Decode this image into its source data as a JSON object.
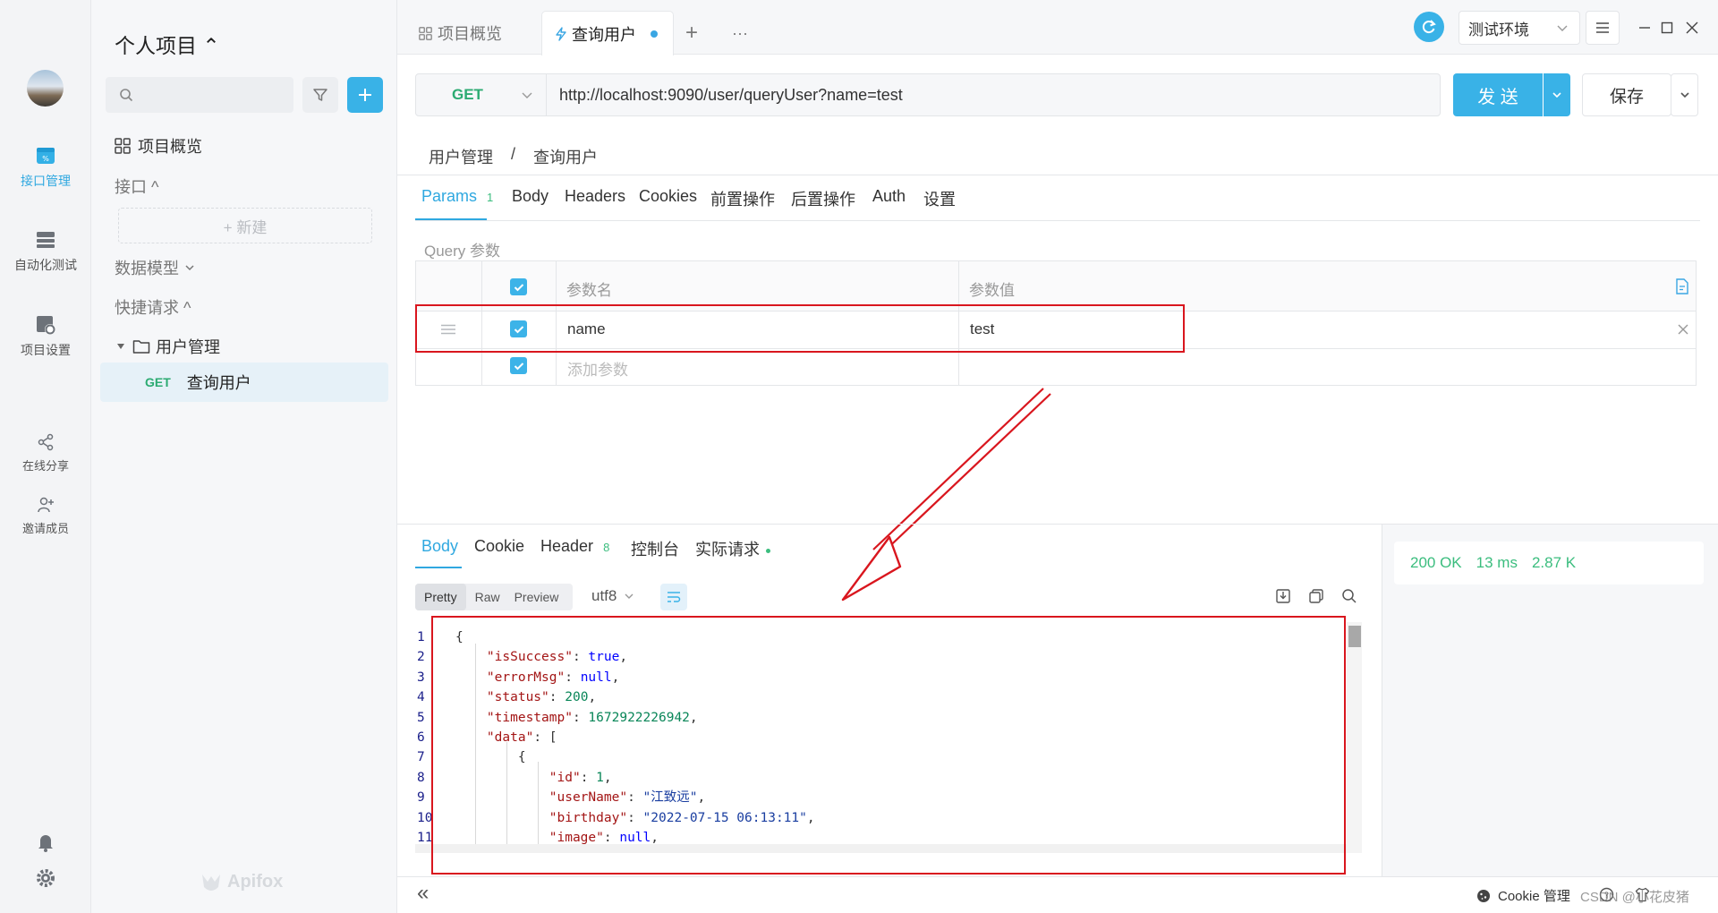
{
  "sidebar_nav": {
    "items": [
      {
        "label": "接口管理",
        "icon": "api-icon",
        "active": true
      },
      {
        "label": "自动化测试",
        "icon": "automation-icon"
      },
      {
        "label": "项目设置",
        "icon": "project-settings-icon"
      },
      {
        "label": "在线分享",
        "icon": "share-icon"
      },
      {
        "label": "邀请成员",
        "icon": "invite-member-icon"
      }
    ]
  },
  "project": {
    "title": "个人项目 ⌃",
    "search_placeholder": "",
    "overview": "项目概览",
    "api_section": "接口 ^",
    "new_label": "+ 新建",
    "data_model": "数据模型",
    "quick_request": "快捷请求 ^",
    "folder": "用户管理",
    "request_method": "GET",
    "request_name": "查询用户",
    "brand": "Apifox"
  },
  "tabs": {
    "overview": "项目概览",
    "active": "查询用户",
    "add": "+",
    "more": "···"
  },
  "env": {
    "selected": "测试环境"
  },
  "request": {
    "method": "GET",
    "url": "http://localhost:9090/user/queryUser?name=test",
    "send_label": "发 送",
    "save_label": "保存",
    "breadcrumb_parent": "用户管理",
    "breadcrumb_sep": "/",
    "breadcrumb_current": "查询用户"
  },
  "param_tabs": [
    {
      "label": "Params",
      "badge": "1",
      "active": true
    },
    {
      "label": "Body"
    },
    {
      "label": "Headers"
    },
    {
      "label": "Cookies"
    },
    {
      "label": "前置操作"
    },
    {
      "label": "后置操作"
    },
    {
      "label": "Auth"
    },
    {
      "label": "设置"
    }
  ],
  "query": {
    "section_label": "Query 参数",
    "col_name": "参数名",
    "col_value": "参数值",
    "rows": [
      {
        "name": "name",
        "value": "test",
        "checked": true
      }
    ],
    "add_placeholder": "添加参数"
  },
  "response_tabs": [
    {
      "label": "Body",
      "active": true
    },
    {
      "label": "Cookie"
    },
    {
      "label": "Header",
      "badge": "8"
    },
    {
      "label": "控制台"
    },
    {
      "label": "实际请求"
    }
  ],
  "view_modes": [
    "Pretty",
    "Raw",
    "Preview"
  ],
  "encoding": "utf8",
  "status": {
    "code": "200 OK",
    "time": "13 ms",
    "size": "2.87 K"
  },
  "body_lines": [
    {
      "n": "1",
      "t": [
        [
          "p",
          "{"
        ]
      ]
    },
    {
      "n": "2",
      "t": [
        [
          "p",
          "    "
        ],
        [
          "k",
          "\"isSuccess\""
        ],
        [
          "p",
          ": "
        ],
        [
          "l",
          "true"
        ],
        [
          "p",
          ","
        ]
      ]
    },
    {
      "n": "3",
      "t": [
        [
          "p",
          "    "
        ],
        [
          "k",
          "\"errorMsg\""
        ],
        [
          "p",
          ": "
        ],
        [
          "l",
          "null"
        ],
        [
          "p",
          ","
        ]
      ]
    },
    {
      "n": "4",
      "t": [
        [
          "p",
          "    "
        ],
        [
          "k",
          "\"status\""
        ],
        [
          "p",
          ": "
        ],
        [
          "n",
          "200"
        ],
        [
          "p",
          ","
        ]
      ]
    },
    {
      "n": "5",
      "t": [
        [
          "p",
          "    "
        ],
        [
          "k",
          "\"timestamp\""
        ],
        [
          "p",
          ": "
        ],
        [
          "n",
          "1672922226942"
        ],
        [
          "p",
          ","
        ]
      ]
    },
    {
      "n": "6",
      "t": [
        [
          "p",
          "    "
        ],
        [
          "k",
          "\"data\""
        ],
        [
          "p",
          ": ["
        ]
      ]
    },
    {
      "n": "7",
      "t": [
        [
          "p",
          "        {"
        ]
      ]
    },
    {
      "n": "8",
      "t": [
        [
          "p",
          "            "
        ],
        [
          "k",
          "\"id\""
        ],
        [
          "p",
          ": "
        ],
        [
          "n",
          "1"
        ],
        [
          "p",
          ","
        ]
      ]
    },
    {
      "n": "9",
      "t": [
        [
          "p",
          "            "
        ],
        [
          "k",
          "\"userName\""
        ],
        [
          "p",
          ": "
        ],
        [
          "s",
          "\"江致远\""
        ],
        [
          "p",
          ","
        ]
      ]
    },
    {
      "n": "10",
      "t": [
        [
          "p",
          "            "
        ],
        [
          "k",
          "\"birthday\""
        ],
        [
          "p",
          ": "
        ],
        [
          "s",
          "\"2022-07-15 06:13:11\""
        ],
        [
          "p",
          ","
        ]
      ]
    },
    {
      "n": "11",
      "t": [
        [
          "p",
          "            "
        ],
        [
          "k",
          "\"image\""
        ],
        [
          "p",
          ": "
        ],
        [
          "l",
          "null"
        ],
        [
          "p",
          ","
        ]
      ]
    }
  ],
  "footer": {
    "cookie_manager": "Cookie 管理",
    "watermark": "CSDN @小花皮猪",
    "collapse": "«"
  }
}
